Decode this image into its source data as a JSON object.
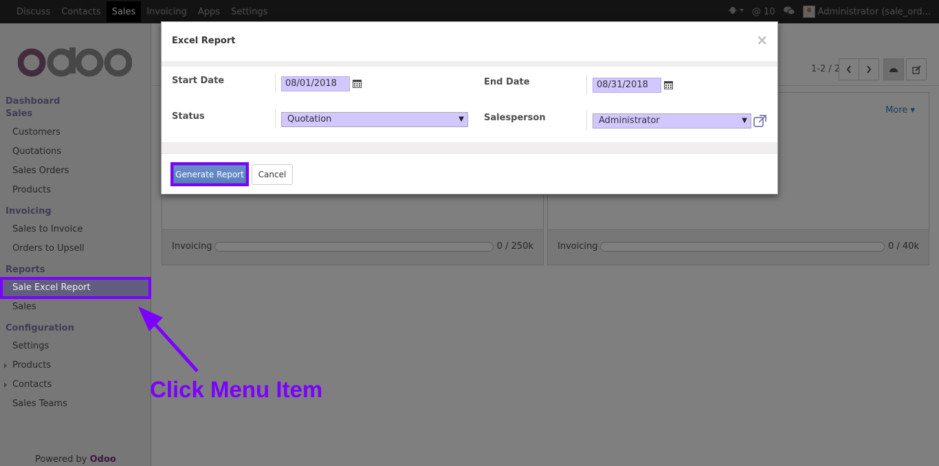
{
  "navbar": {
    "menu": [
      {
        "label": "Discuss",
        "active": false
      },
      {
        "label": "Contacts",
        "active": false
      },
      {
        "label": "Sales",
        "active": true
      },
      {
        "label": "Invoicing",
        "active": false
      },
      {
        "label": "Apps",
        "active": false
      },
      {
        "label": "Settings",
        "active": false
      }
    ],
    "mentions_count": "@ 10",
    "user": "Administrator (sale_ord..."
  },
  "sidebar": {
    "sections": [
      {
        "heading": "Dashboard"
      },
      {
        "heading": "Sales",
        "items": [
          "Customers",
          "Quotations",
          "Sales Orders",
          "Products"
        ]
      },
      {
        "heading": "Invoicing",
        "items": [
          "Sales to Invoice",
          "Orders to Upsell"
        ]
      },
      {
        "heading": "Reports",
        "items": [
          "Sale Excel Report",
          "Sales"
        ]
      },
      {
        "heading": "Configuration",
        "items": [
          "Settings",
          "Products",
          "Contacts",
          "Sales Teams"
        ]
      }
    ],
    "powered_by": "Powered by",
    "powered_brand": "Odoo"
  },
  "main": {
    "pager": "1-2 / 2",
    "cards": [
      {
        "footer_label": "Invoicing",
        "footer_value": "0 / 250k"
      },
      {
        "footer_label": "Invoicing",
        "footer_value": "0 / 40k",
        "more": "More"
      }
    ]
  },
  "modal": {
    "title": "Excel Report",
    "close": "×",
    "fields": {
      "start_date_label": "Start Date",
      "start_date_value": "08/01/2018",
      "end_date_label": "End Date",
      "end_date_value": "08/31/2018",
      "status_label": "Status",
      "status_value": "Quotation",
      "salesperson_label": "Salesperson",
      "salesperson_value": "Administrator"
    },
    "generate_label": "Generate Report",
    "cancel_label": "Cancel"
  },
  "annotation": "Click Menu Item",
  "colors": {
    "accent": "#7c00ff",
    "odoo_purple": "#7c7bad",
    "brand": "#875a7b"
  }
}
